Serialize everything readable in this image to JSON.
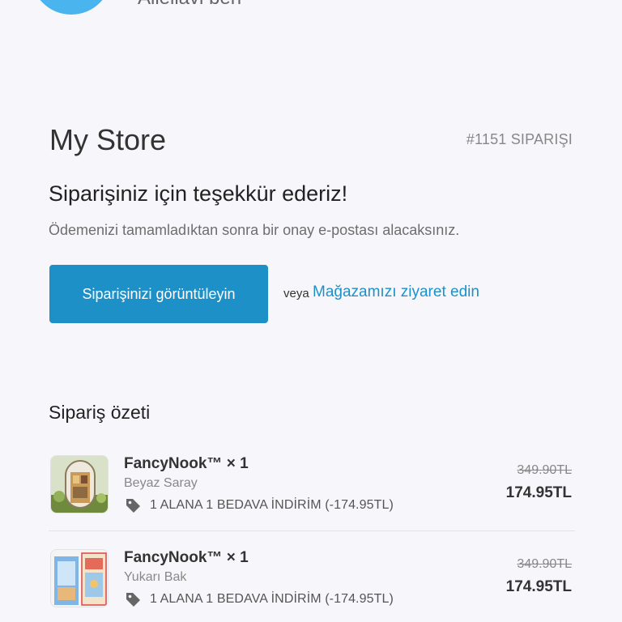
{
  "header": {
    "name_partial": "Alleliavi ben"
  },
  "store": {
    "title": "My Store",
    "order_number": "#1151 SIPARIŞI"
  },
  "confirmation": {
    "thanks": "Siparişiniz için teşekkür ederiz!",
    "subtext": "Ödemenizi tamamladıktan sonra bir onay e-postası alacaksınız."
  },
  "actions": {
    "view_order_label": "Siparişinizi görüntüleyin",
    "or_label": "veya",
    "visit_store_label": "Mağazamızı ziyaret edin"
  },
  "summary": {
    "title": "Sipariş özeti",
    "items": [
      {
        "title": "FancyNook™ × 1",
        "variant": "Beyaz Saray",
        "discount": "1 ALANA 1 BEDAVA İNDİRİM (-174.95TL)",
        "old_price": "349.90TL",
        "price": "174.95TL",
        "icon": "tag-icon"
      },
      {
        "title": "FancyNook™ × 1",
        "variant": "Yukarı Bak",
        "discount": "1 ALANA 1 BEDAVA İNDİRİM (-174.95TL)",
        "old_price": "349.90TL",
        "price": "174.95TL",
        "icon": "tag-icon"
      }
    ]
  },
  "colors": {
    "accent": "#1d90c8",
    "avatar": "#4ab4ee",
    "background": "#f7f7fb"
  }
}
